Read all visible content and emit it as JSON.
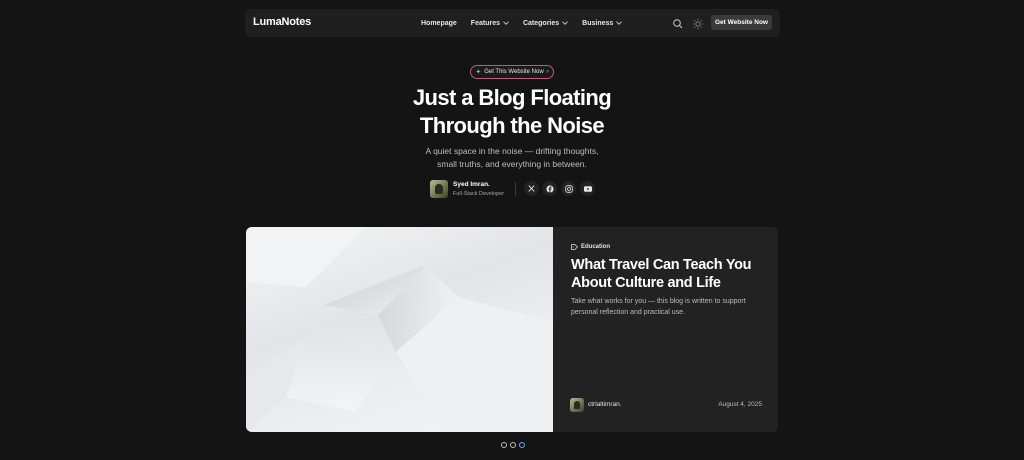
{
  "brand": {
    "name": "LumaNotes"
  },
  "nav": {
    "links": [
      {
        "label": "Homepage",
        "has_dropdown": false
      },
      {
        "label": "Features",
        "has_dropdown": true
      },
      {
        "label": "Categories",
        "has_dropdown": true
      },
      {
        "label": "Business",
        "has_dropdown": true
      }
    ],
    "search_icon": "search-icon",
    "theme_icon": "sun-icon",
    "cta_label": "Get Website Now"
  },
  "hero": {
    "pill_label": "Get This Website Now",
    "pill_icon": "sparkle-icon",
    "title_line1": "Just a Blog Floating",
    "title_line2": "Through the Noise",
    "subtitle_line1": "A quiet space in the noise — drifting thoughts,",
    "subtitle_line2": "small truths, and everything in between.",
    "author": {
      "name": "Syed Imran.",
      "role": "Full-Stack Developer"
    },
    "socials": [
      "x-icon",
      "facebook-icon",
      "instagram-icon",
      "youtube-icon"
    ]
  },
  "featured_post": {
    "category": "Education",
    "category_icon": "tag-icon",
    "title": "What Travel Can Teach You About Culture and Life",
    "excerpt": "Take what works for you — this blog is written to support personal reflection and practical use.",
    "author": "ctrlaltimran.",
    "date": "August 4, 2025"
  },
  "carousel": {
    "slide_count": 3,
    "active_index": 2
  },
  "colors": {
    "background": "#141414",
    "card": "#222222",
    "pill_border": "#c25a7a",
    "active_dot": "#6fa3ff"
  }
}
